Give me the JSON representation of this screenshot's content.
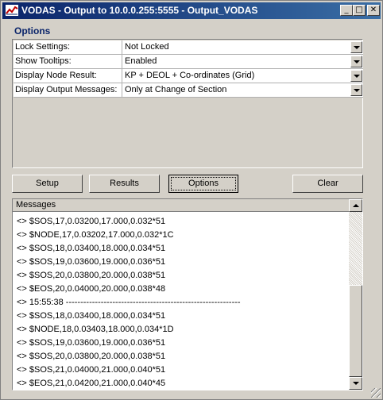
{
  "window": {
    "title": "VODAS - Output to 10.0.0.255:5555 - Output_VODAS",
    "controls": {
      "minimize": "_",
      "maximize": "□",
      "close": "✕"
    }
  },
  "options_label": "Options",
  "settings": [
    {
      "key": "Lock Settings:",
      "value": "Not Locked"
    },
    {
      "key": "Show Tooltips:",
      "value": "Enabled"
    },
    {
      "key": "Display Node Result:",
      "value": "KP + DEOL + Co-ordinates (Grid)"
    },
    {
      "key": "Display Output Messages:",
      "value": "Only at Change of Section"
    }
  ],
  "buttons": {
    "setup": "Setup",
    "results": "Results",
    "options": "Options",
    "clear": "Clear"
  },
  "messages": {
    "header": "Messages",
    "items": [
      "<> $SOS,17,0.03200,17.000,0.032*51",
      "<> $NODE,17,0.03202,17.000,0.032*1C",
      "<> $SOS,18,0.03400,18.000,0.034*51",
      "<> $SOS,19,0.03600,19.000,0.036*51",
      "<> $SOS,20,0.03800,20.000,0.038*51",
      "<> $EOS,20,0.04000,20.000,0.038*48",
      "<> 15:55:38 ------------------------------------------------------------",
      "<> $SOS,18,0.03400,18.000,0.034*51",
      "<> $NODE,18,0.03403,18.000,0.034*1D",
      "<> $SOS,19,0.03600,19.000,0.036*51",
      "<> $SOS,20,0.03800,20.000,0.038*51",
      "<> $SOS,21,0.04000,21.000,0.040*51",
      "<> $EOS,21,0.04200,21.000,0.040*45"
    ]
  }
}
